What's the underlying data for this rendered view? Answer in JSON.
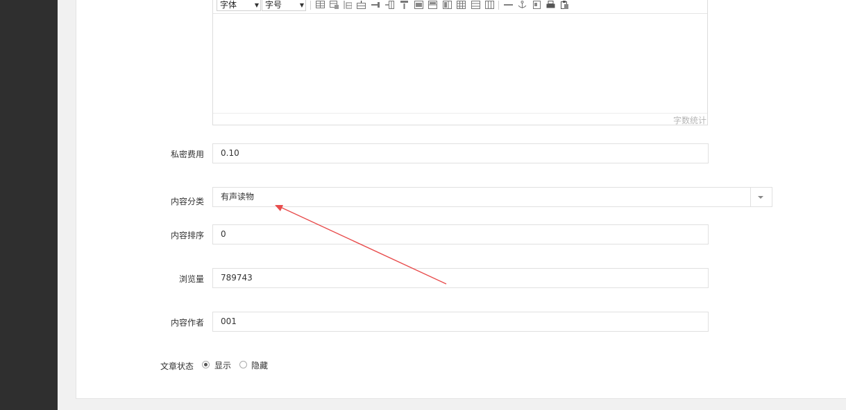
{
  "editor": {
    "font_select": "字体",
    "size_select": "字号",
    "word_count": "字数统计"
  },
  "form": {
    "private_fee": {
      "label": "私密费用",
      "value": "0.10"
    },
    "category": {
      "label": "内容分类",
      "value": "有声读物"
    },
    "sort": {
      "label": "内容排序",
      "value": "0"
    },
    "views": {
      "label": "浏览量",
      "value": "789743"
    },
    "author": {
      "label": "内容作者",
      "value": "001"
    },
    "status": {
      "label": "文章状态",
      "options": [
        {
          "label": "显示",
          "checked": true
        },
        {
          "label": "隐藏",
          "checked": false
        }
      ]
    }
  },
  "annotation": {
    "arrow_color": "#e84c4c"
  }
}
